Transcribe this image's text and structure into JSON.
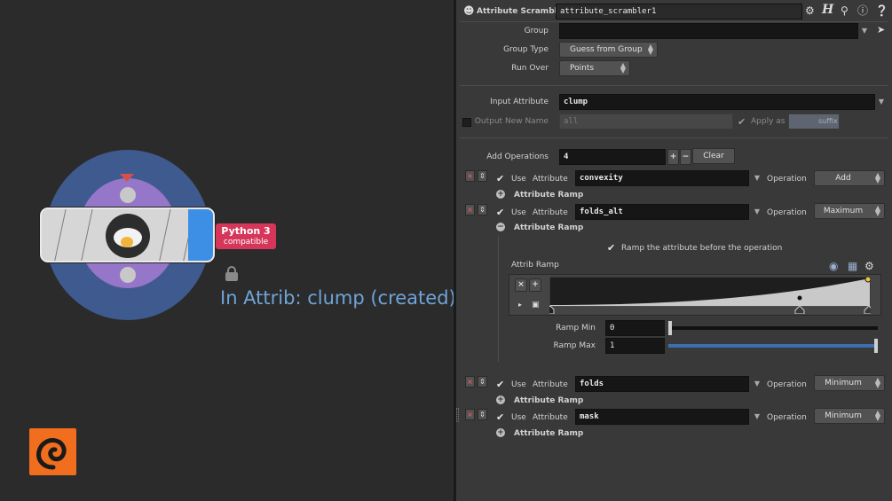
{
  "network": {
    "badge": {
      "title": "Python 3",
      "subtitle": "compatible"
    },
    "node_info": "In Attrib: clump (created)"
  },
  "parm_pane": {
    "header": {
      "node_type": "Attribute Scrambler",
      "node_name": "attribute_scrambler1"
    },
    "group": {
      "label": "Group",
      "value": ""
    },
    "group_type": {
      "label": "Group Type",
      "value": "Guess from Group"
    },
    "run_over": {
      "label": "Run Over",
      "value": "Points"
    },
    "input_attribute": {
      "label": "Input Attribute",
      "value": "clump"
    },
    "output_new_name": {
      "label": "Output New Name",
      "value": "all",
      "apply_as_label": "Apply as",
      "apply_as_value": "suffix"
    },
    "add_operations": {
      "label": "Add Operations",
      "value": "4",
      "clear_label": "Clear"
    },
    "operations": [
      {
        "use_label": "Use",
        "attribute_label": "Attribute",
        "attribute": "convexity",
        "operation_label": "Operation",
        "operation": "Add",
        "ramp_label": "Attribute Ramp"
      },
      {
        "use_label": "Use",
        "attribute_label": "Attribute",
        "attribute": "folds_alt",
        "operation_label": "Operation",
        "operation": "Maximum",
        "ramp_label": "Attribute Ramp"
      },
      {
        "use_label": "Use",
        "attribute_label": "Attribute",
        "attribute": "folds",
        "operation_label": "Operation",
        "operation": "Minimum",
        "ramp_label": "Attribute Ramp"
      },
      {
        "use_label": "Use",
        "attribute_label": "Attribute",
        "attribute": "mask",
        "operation_label": "Operation",
        "operation": "Minimum",
        "ramp_label": "Attribute Ramp"
      }
    ],
    "ramp_section": {
      "ramp_before_label": "Ramp the attribute before the operation",
      "attrib_ramp_label": "Attrib Ramp",
      "ramp_min": {
        "label": "Ramp Min",
        "value": "0",
        "level": 0.0
      },
      "ramp_max": {
        "label": "Ramp Max",
        "value": "1",
        "level": 1.0
      }
    }
  },
  "colors": {
    "accent_blue": "#3d8fe6",
    "badge_red": "#d6365a",
    "info_blue": "#6fa4d8",
    "houdini_orange": "#f06e1e"
  }
}
